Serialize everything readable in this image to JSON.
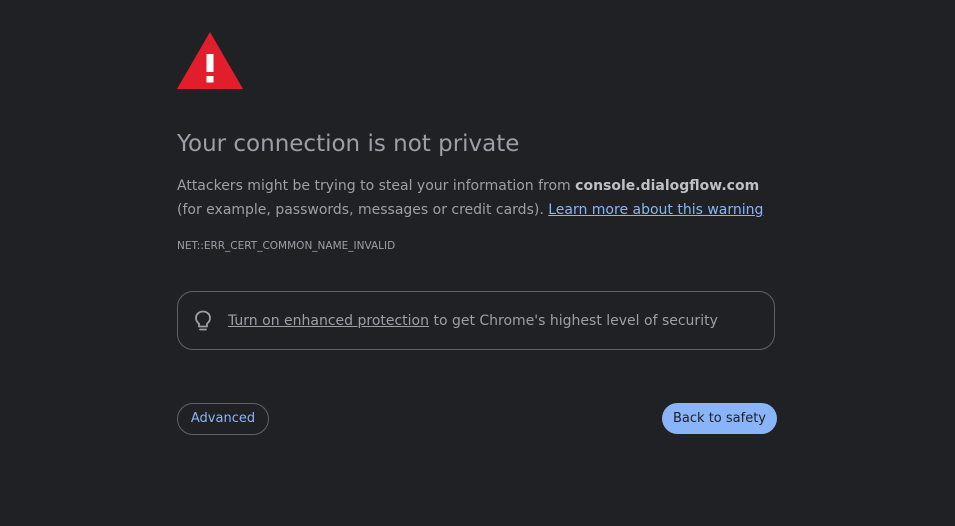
{
  "icons": {
    "warning": "warning-triangle-icon",
    "bulb": "lightbulb-icon"
  },
  "colors": {
    "background": "#202124",
    "warning_red": "#e21e2d",
    "link_blue": "#8ab4f8",
    "text_gray": "#9aa0a6"
  },
  "heading": "Your connection is not private",
  "description": {
    "prefix": "Attackers might be trying to steal your information from ",
    "host": "console.dialogflow.com",
    "suffix": " (for example, passwords, messages or credit cards). ",
    "learn_more": "Learn more about this warning"
  },
  "error_code": "NET::ERR_CERT_COMMON_NAME_INVALID",
  "enhanced_protection": {
    "link": "Turn on enhanced protection",
    "text": " to get Chrome's highest level of security"
  },
  "buttons": {
    "advanced": "Advanced",
    "back_to_safety": "Back to safety"
  }
}
